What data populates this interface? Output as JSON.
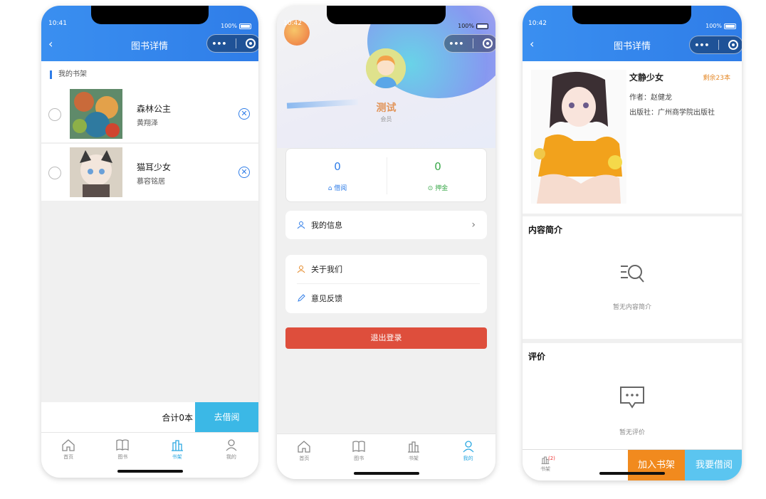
{
  "colors": {
    "primary_blue": "#2f7de8",
    "accent_cyan": "#3bb8e6",
    "logout_red": "#de4e3c",
    "orange": "#f18a1e",
    "stat_blue": "#2f7de8",
    "stat_green": "#3aa84a"
  },
  "status": {
    "time1": "10:41",
    "time2": "10:42",
    "time3": "10:42",
    "battery": "100%"
  },
  "capsule": {
    "dots": "•••"
  },
  "shelf_screen": {
    "nav_title": "图书详情",
    "section_label": "我的书架",
    "books": [
      {
        "title": "森林公主",
        "author": "黄翔泽"
      },
      {
        "title": "猫耳少女",
        "author": "慕容铭居"
      }
    ],
    "total_label": "合计0本",
    "borrow_button": "去借阅"
  },
  "tabbar": {
    "home": "首页",
    "books": "图书",
    "shelf": "书架",
    "mine": "我的"
  },
  "profile_screen": {
    "name": "测试",
    "role": "会员",
    "borrow_count": "0",
    "borrow_label": "借阅",
    "deposit_count": "0",
    "deposit_label": "押金",
    "my_info": "我的信息",
    "about_us": "关于我们",
    "feedback": "意见反馈",
    "logout": "退出登录"
  },
  "detail_screen": {
    "nav_title": "图书详情",
    "book_title": "文静少女",
    "stock": "剩余23本",
    "author_line": "作者：赵健龙",
    "publisher_line": "出版社：广州商学院出版社",
    "intro_title": "内容简介",
    "intro_empty": "暂无内容简介",
    "review_title": "评价",
    "review_empty": "暂无评价",
    "shelf_label": "书架",
    "shelf_badge": "(2)",
    "add_shelf": "加入书架",
    "borrow_now": "我要借阅"
  }
}
